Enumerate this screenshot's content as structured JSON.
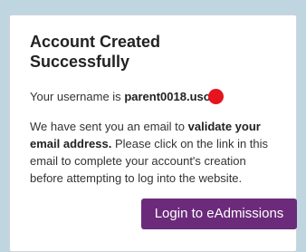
{
  "dialog": {
    "title_line1": "Account Created",
    "title_line2": "Successfully",
    "username_prefix": "Your username is ",
    "username_value": "parent0018.uso",
    "message": {
      "part1": "We have sent you an email to ",
      "bold": "validate your email address.",
      "part2": " Please click on the link in this email to complete your account's creation before attempting to log into the website."
    },
    "login_button_label": "Login to eAdmissions"
  },
  "colors": {
    "background": "#bfd6e0",
    "card": "#ffffff",
    "button": "#6b2b7a",
    "redaction": "#e6141e"
  }
}
